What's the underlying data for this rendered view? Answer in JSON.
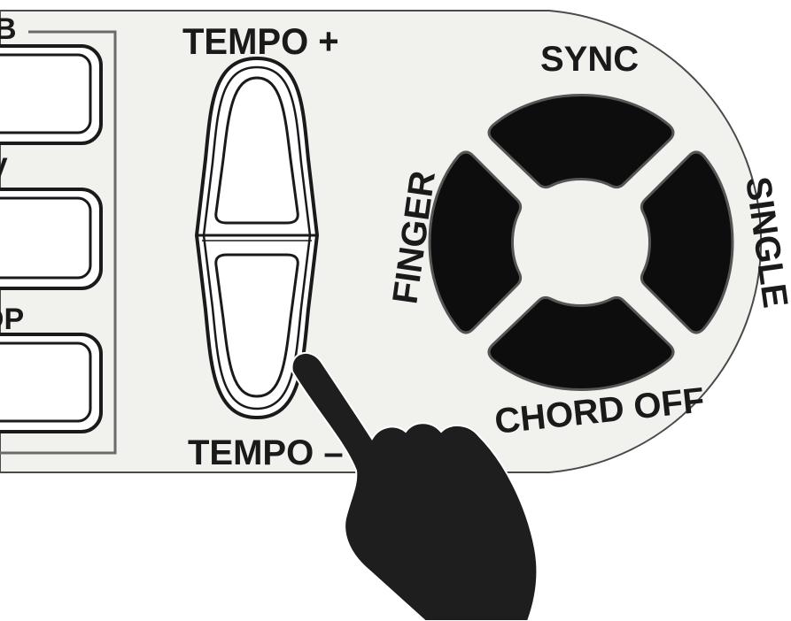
{
  "tempo": {
    "plus_label": "TEMPO +",
    "minus_label": "TEMPO –"
  },
  "dpad": {
    "top_label": "SYNC",
    "left_label": "FINGER",
    "right_label": "SINGLE",
    "bottom_label": "CHORD OFF"
  },
  "side_panel": {
    "partial_labels": [
      "B",
      "V",
      "OP"
    ]
  },
  "colors": {
    "panel": "#f1f1ee",
    "outline": "#3a3a3a",
    "button_fill": "#0d0d0d",
    "hand": "#1e1e1e"
  },
  "icons": {
    "hand": "pointing-hand-icon"
  }
}
